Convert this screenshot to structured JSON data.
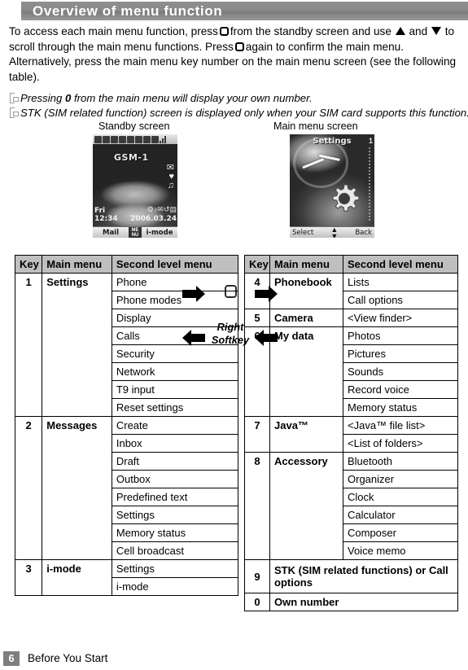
{
  "header": {
    "title": "Overview of menu function"
  },
  "intro": {
    "part1": "To access each main menu function, press",
    "part2": "from the standby screen and use",
    "and": "and",
    "part3": "to scroll through the main menu functions. Press",
    "part4": "again to confirm the main menu. Alternatively, press the main menu key number on the main menu screen (see the following table)."
  },
  "notes": [
    {
      "pre": "Pressing ",
      "bold": "0",
      "post": " from the main menu will display your own number."
    },
    {
      "pre": "STK (SIM related function) screen is displayed only when your SIM card supports this function.",
      "bold": "",
      "post": ""
    }
  ],
  "figure": {
    "standby_label": "Standby screen",
    "mainmenu_label": "Main menu screen",
    "right_softkey_line1": "Right",
    "right_softkey_line2": "Softkey",
    "standby_screen": {
      "network": "GSM-1",
      "day": "Fri",
      "time": "12:34",
      "date": "2006.03.24",
      "softkey_left": "Mail",
      "softkey_center_line1": "ME",
      "softkey_center_line2": "NU",
      "softkey_right": "i-mode",
      "glyphs": [
        "✉",
        "♥",
        "♫"
      ],
      "tray": "⚙♪✉↺▤"
    },
    "mainmenu_screen": {
      "title": "Settings",
      "index": "1",
      "softkey_left": "Select",
      "softkey_right": "Back"
    }
  },
  "tables": {
    "headers": {
      "key": "Key",
      "main": "Main menu",
      "second": "Second level menu"
    },
    "left": [
      {
        "key": "1",
        "main": "Settings",
        "items": [
          "Phone",
          "Phone modes",
          "Display",
          "Calls",
          "Security",
          "Network",
          "T9 input",
          "Reset settings"
        ]
      },
      {
        "key": "2",
        "main": "Messages",
        "items": [
          "Create",
          "Inbox",
          "Draft",
          "Outbox",
          "Predefined text",
          "Settings",
          "Memory status",
          "Cell broadcast"
        ]
      },
      {
        "key": "3",
        "main": "i-mode",
        "items": [
          "Settings",
          "i-mode"
        ]
      }
    ],
    "right": [
      {
        "key": "4",
        "main": "Phonebook",
        "items": [
          "Lists",
          "Call options"
        ]
      },
      {
        "key": "5",
        "main": "Camera",
        "items": [
          "<View finder>"
        ]
      },
      {
        "key": "6",
        "main": "My data",
        "items": [
          "Photos",
          "Pictures",
          "Sounds",
          "Record voice",
          "Memory status"
        ]
      },
      {
        "key": "7",
        "main": "Java™",
        "items": [
          "<Java™ file list>",
          "<List of folders>"
        ]
      },
      {
        "key": "8",
        "main": "Accessory",
        "items": [
          "Bluetooth",
          "Organizer",
          "Clock",
          "Calculator",
          "Composer",
          "Voice memo"
        ]
      },
      {
        "key": "9",
        "main": "STK (SIM related functions) or Call options",
        "items": [],
        "span": true
      },
      {
        "key": "0",
        "main": "Own number",
        "items": [],
        "span": true
      }
    ]
  },
  "footer": {
    "page": "6",
    "section": "Before You Start"
  }
}
